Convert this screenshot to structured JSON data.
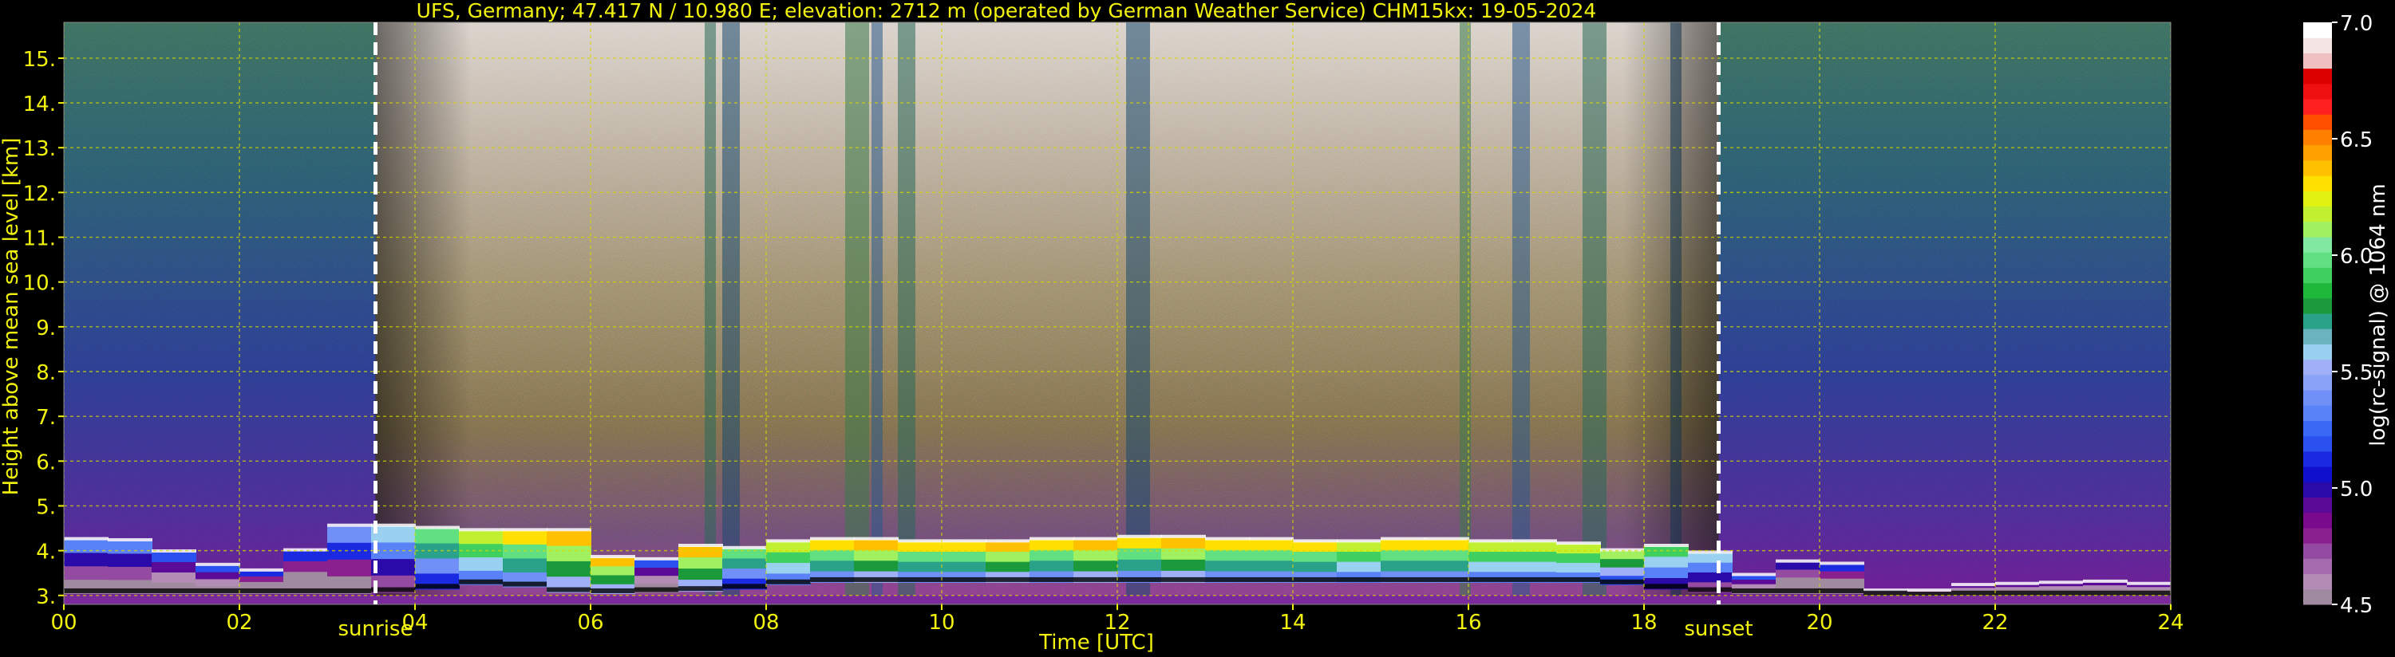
{
  "chart_data": {
    "type": "heatmap",
    "title": "UFS, Germany; 47.417 N / 10.980 E; elevation: 2712 m  (operated by German Weather Service)    CHM15kx: 19-05-2024",
    "xlabel": "Time [UTC]",
    "ylabel": "Height above mean sea level [km]",
    "xlim": [
      0,
      24
    ],
    "ylim": [
      2.8,
      15.8
    ],
    "x_ticks": [
      "00",
      "02",
      "04",
      "06",
      "08",
      "10",
      "12",
      "14",
      "16",
      "18",
      "20",
      "22",
      "24"
    ],
    "y_ticks": [
      "3.",
      "4.",
      "5.",
      "6.",
      "7.",
      "8.",
      "9.",
      "10.",
      "11.",
      "12.",
      "13.",
      "14.",
      "15."
    ],
    "grid": true,
    "annotations": [
      {
        "label": "sunrise",
        "x_hours": 3.55
      },
      {
        "label": "sunset",
        "x_hours": 18.85
      }
    ],
    "colorbar": {
      "label": "log(rc-signal) @ 1064 nm",
      "range": [
        4.5,
        7.0
      ],
      "ticks": [
        "7.0",
        "6.5",
        "6.0",
        "5.5",
        "5.0",
        "4.5"
      ],
      "colors": [
        "#a08aa0",
        "#b28cb4",
        "#a66aae",
        "#944aa0",
        "#8a1f8f",
        "#7a0a8c",
        "#5a0a96",
        "#2a0aa8",
        "#1010cc",
        "#1a2ae0",
        "#2a50f0",
        "#3a6af5",
        "#5a82f8",
        "#7090f8",
        "#8aa2f8",
        "#a0b0f8",
        "#9ad0f0",
        "#6ab4c0",
        "#2aa28a",
        "#1a9a3a",
        "#20b83a",
        "#40d060",
        "#60e080",
        "#80e8a0",
        "#a0f060",
        "#c0f030",
        "#e0f010",
        "#ffe000",
        "#ffc000",
        "#ffa000",
        "#ff8000",
        "#ff5000",
        "#ff2020",
        "#ee1010",
        "#dd0000",
        "#f0c0c0",
        "#f4e4e4",
        "#ffffff"
      ]
    },
    "cloud_layer": [
      {
        "t": 0.0,
        "base": 3.05,
        "top": 4.25,
        "int": 5.3
      },
      {
        "t": 0.5,
        "base": 3.05,
        "top": 4.25,
        "int": 5.3
      },
      {
        "t": 1.0,
        "base": 3.05,
        "top": 4.2,
        "int": 5.2
      },
      {
        "t": 1.5,
        "base": 3.05,
        "top": 3.75,
        "int": 5.2
      },
      {
        "t": 2.0,
        "base": 3.05,
        "top": 3.6,
        "int": 5.1
      },
      {
        "t": 2.5,
        "base": 3.05,
        "top": 3.5,
        "int": 5.1
      },
      {
        "t": 3.0,
        "base": 3.05,
        "top": 4.5,
        "int": 5.4
      },
      {
        "t": 3.5,
        "base": 3.05,
        "top": 4.6,
        "int": 5.6
      },
      {
        "t": 4.0,
        "base": 3.1,
        "top": 4.5,
        "int": 6.0
      },
      {
        "t": 4.5,
        "base": 3.2,
        "top": 4.5,
        "int": 6.2
      },
      {
        "t": 5.0,
        "base": 3.3,
        "top": 4.4,
        "int": 6.3
      },
      {
        "t": 5.5,
        "base": 3.1,
        "top": 4.5,
        "int": 6.4
      },
      {
        "t": 6.0,
        "base": 3.05,
        "top": 4.4,
        "int": 6.4
      },
      {
        "t": 6.5,
        "base": 3.05,
        "top": 3.3,
        "int": 5.2
      },
      {
        "t": 7.0,
        "base": 3.1,
        "top": 4.3,
        "int": 6.4
      },
      {
        "t": 7.5,
        "base": 3.1,
        "top": 3.9,
        "int": 6.0
      },
      {
        "t": 8.0,
        "base": 3.2,
        "top": 4.2,
        "int": 6.2
      },
      {
        "t": 8.5,
        "base": 3.3,
        "top": 4.2,
        "int": 6.3
      },
      {
        "t": 9.0,
        "base": 3.3,
        "top": 4.3,
        "int": 6.4
      },
      {
        "t": 9.5,
        "base": 3.3,
        "top": 4.2,
        "int": 6.3
      },
      {
        "t": 10.0,
        "base": 3.3,
        "top": 4.2,
        "int": 6.3
      },
      {
        "t": 10.5,
        "base": 3.3,
        "top": 4.2,
        "int": 6.4
      },
      {
        "t": 11.0,
        "base": 3.3,
        "top": 4.2,
        "int": 6.3
      },
      {
        "t": 11.5,
        "base": 3.3,
        "top": 4.3,
        "int": 6.4
      },
      {
        "t": 12.0,
        "base": 3.3,
        "top": 4.2,
        "int": 6.3
      },
      {
        "t": 12.5,
        "base": 3.3,
        "top": 4.4,
        "int": 6.4
      },
      {
        "t": 13.0,
        "base": 3.3,
        "top": 4.2,
        "int": 6.3
      },
      {
        "t": 13.5,
        "base": 3.3,
        "top": 4.3,
        "int": 6.3
      },
      {
        "t": 14.0,
        "base": 3.3,
        "top": 4.2,
        "int": 6.3
      },
      {
        "t": 14.5,
        "base": 3.3,
        "top": 4.2,
        "int": 6.2
      },
      {
        "t": 15.0,
        "base": 3.3,
        "top": 4.2,
        "int": 6.3
      },
      {
        "t": 15.5,
        "base": 3.3,
        "top": 4.3,
        "int": 6.3
      },
      {
        "t": 16.0,
        "base": 3.3,
        "top": 4.2,
        "int": 6.2
      },
      {
        "t": 16.5,
        "base": 3.3,
        "top": 4.2,
        "int": 6.2
      },
      {
        "t": 17.0,
        "base": 3.3,
        "top": 4.2,
        "int": 6.2
      },
      {
        "t": 17.5,
        "base": 3.3,
        "top": 4.1,
        "int": 6.1
      },
      {
        "t": 18.0,
        "base": 3.2,
        "top": 3.9,
        "int": 5.9
      },
      {
        "t": 18.5,
        "base": 3.1,
        "top": 4.3,
        "int": 5.6
      },
      {
        "t": 19.0,
        "base": 3.05,
        "top": 3.6,
        "int": 5.2
      },
      {
        "t": 19.5,
        "base": 3.05,
        "top": 3.3,
        "int": 5.0
      },
      {
        "t": 20.0,
        "base": 3.05,
        "top": 4.2,
        "int": 5.1
      },
      {
        "t": 20.5,
        "base": 3.05,
        "top": 3.2,
        "int": 4.9
      },
      {
        "t": 21.0,
        "base": 2.95,
        "top": 3.0,
        "int": 4.8
      },
      {
        "t": 21.5,
        "base": 3.0,
        "top": 3.2,
        "int": 4.9
      },
      {
        "t": 22.0,
        "base": 3.0,
        "top": 3.25,
        "int": 4.9
      },
      {
        "t": 22.5,
        "base": 3.0,
        "top": 3.25,
        "int": 4.9
      },
      {
        "t": 23.0,
        "base": 3.0,
        "top": 3.3,
        "int": 4.9
      },
      {
        "t": 23.5,
        "base": 3.0,
        "top": 3.3,
        "int": 4.9
      },
      {
        "t": 24.0,
        "base": 3.0,
        "top": 3.2,
        "int": 4.9
      }
    ]
  }
}
